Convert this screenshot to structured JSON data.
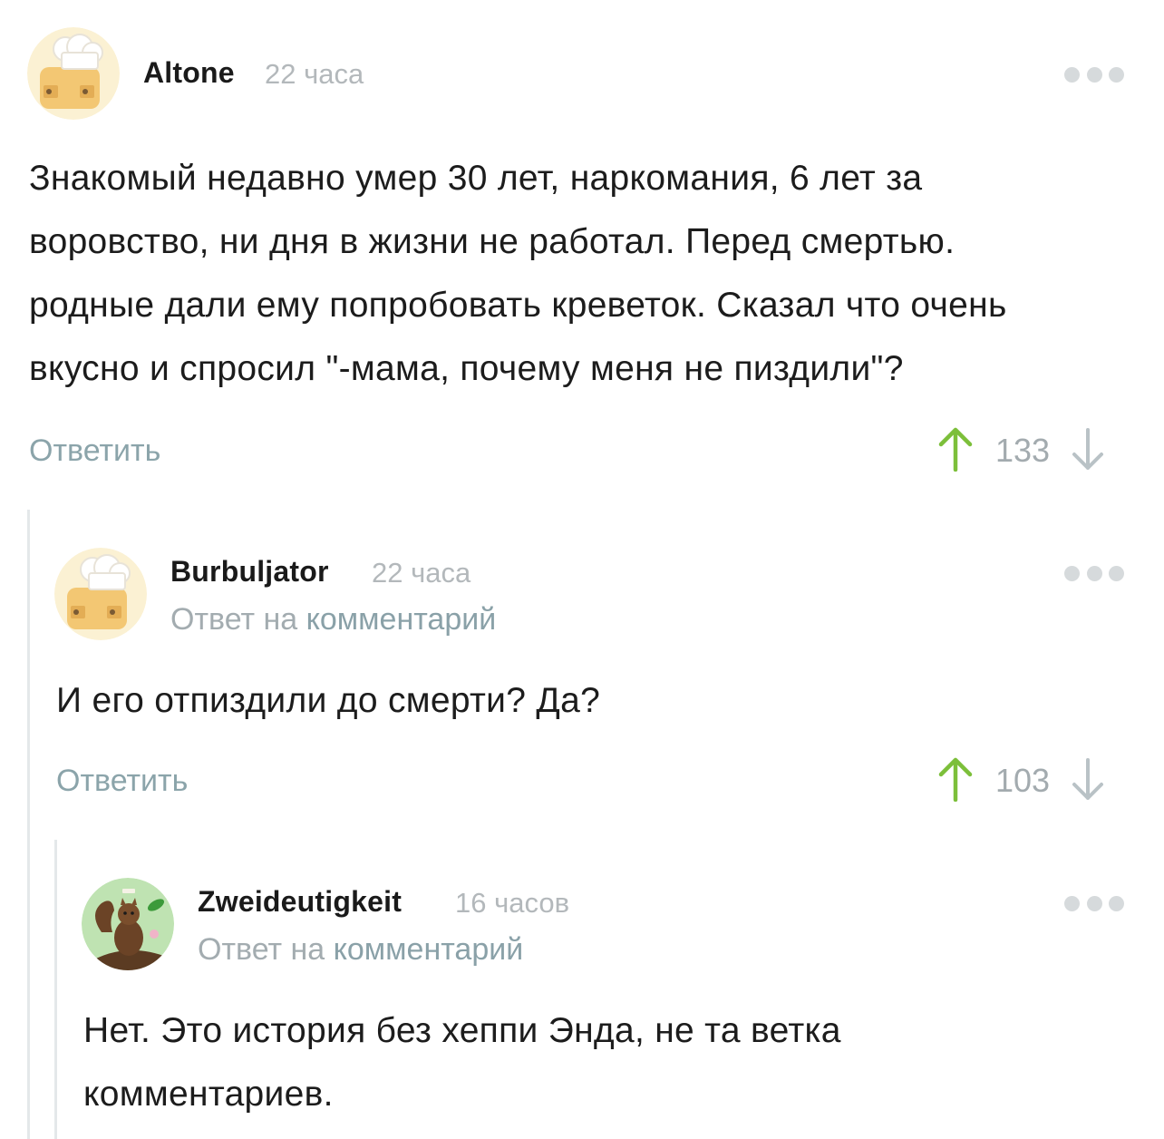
{
  "comments": [
    {
      "author": "Altone",
      "time": "22 часа",
      "avatar_icon": "chef-toast-avatar",
      "text_lines": [
        "Знакомый недавно умер 30 лет, наркомания, 6 лет за",
        "воровство, ни дня в жизни не работал. Перед смертью.",
        "родные дали ему попробовать креветок. Сказал что очень",
        "вкусно и спросил \"-мама, почему меня не пиздили\"?"
      ],
      "reply_label": "Ответить",
      "rating": "133"
    },
    {
      "author": "Burbuljator",
      "time": "22 часа",
      "avatar_icon": "chef-toast-avatar",
      "reply_to_prefix": "Ответ на",
      "reply_to_link": "комментарий",
      "text_lines": [
        "И его отпиздили до смерти? Да?"
      ],
      "reply_label": "Ответить",
      "rating": "103"
    },
    {
      "author": "Zweideutigkeit",
      "time": "16 часов",
      "avatar_icon": "squirrel-avatar",
      "reply_to_prefix": "Ответ на",
      "reply_to_link": "комментарий",
      "text_lines": [
        "Нет. Это история без хеппи Энда, не та ветка",
        "комментариев."
      ]
    }
  ],
  "colors": {
    "upvote": "#7cbf3a",
    "downvote": "#b9c2c6",
    "link": "#8aa1a8",
    "thread_line": "#e4e8ea"
  }
}
